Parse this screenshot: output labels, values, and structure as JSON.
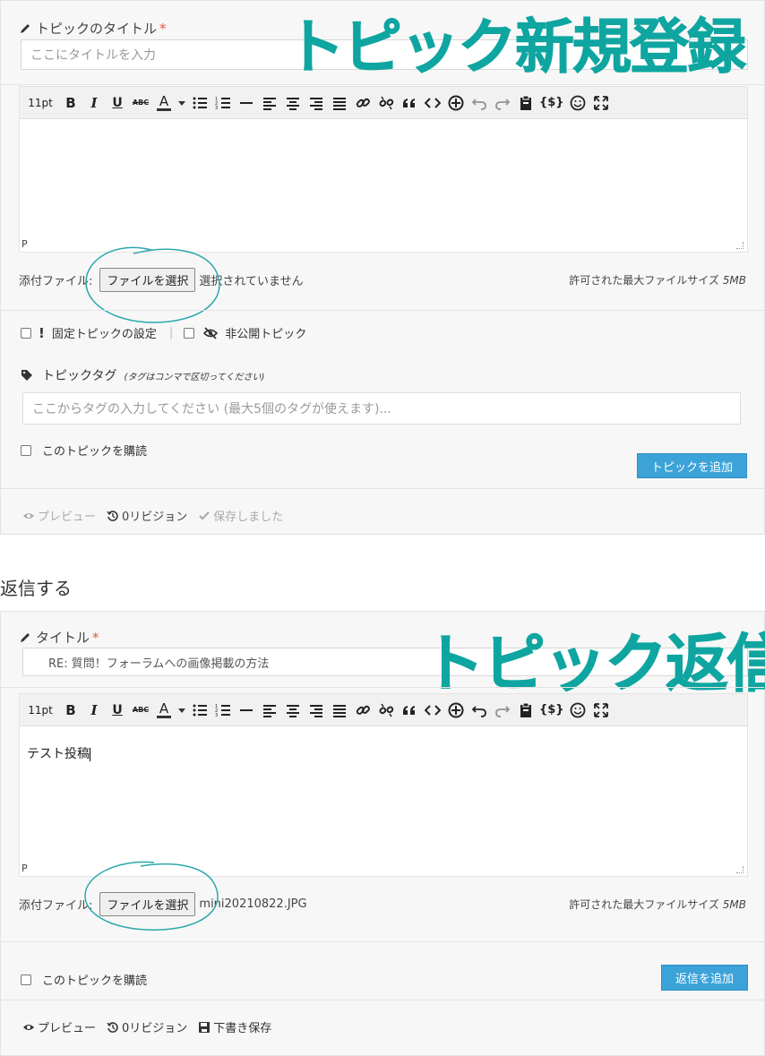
{
  "new_topic": {
    "title_label": "トピックのタイトル",
    "required_mark": "*",
    "title_placeholder": "ここにタイトルを入力",
    "stamp": "トピック新規登録",
    "editor": {
      "font_size": "11pt",
      "bold": "B",
      "italic": "I",
      "underline": "U",
      "strike": "ABC",
      "color": "A",
      "content": "",
      "status": "P"
    },
    "attach_label": "添付ファイル:",
    "file_button": "ファイルを選択",
    "file_status": "選択されていません",
    "max_size_label": "許可された最大ファイルサイズ",
    "max_size_value": "5MB",
    "sticky_label": "固定トピックの設定",
    "separator": "|",
    "private_label": "非公開トピック",
    "tags_label": "トピックタグ",
    "tags_hint": "(タグはコンマで区切ってください)",
    "tags_placeholder": "ここからタグの入力してください (最大5個のタグが使えます)...",
    "subscribe_label": "このトピックを購読",
    "submit_button": "トピックを追加",
    "footer": {
      "preview": "プレビュー",
      "revisions": "0リビジョン",
      "saved": "保存しました"
    }
  },
  "reply_heading": "返信する",
  "reply": {
    "title_label": "タイトル",
    "required_mark": "*",
    "title_value": "RE: 質問！フォーラムへの画像掲載の方法",
    "stamp": "トピック返信",
    "editor": {
      "font_size": "11pt",
      "bold": "B",
      "italic": "I",
      "underline": "U",
      "strike": "ABC",
      "color": "A",
      "content": "テスト投稿",
      "status": "P"
    },
    "attach_label": "添付ファイル:",
    "file_button": "ファイルを選択",
    "file_status": "mini20210822.JPG",
    "max_size_label": "許可された最大ファイルサイズ",
    "max_size_value": "5MB",
    "subscribe_label": "このトピックを購読",
    "submit_button": "返信を追加",
    "footer": {
      "preview": "プレビュー",
      "revisions": "0リビジョン",
      "draft": "下書き保存"
    }
  },
  "colors": {
    "accent_blue": "#3ca3d8",
    "stamp_teal": "#0fa5a0",
    "required_red": "#e2593a"
  }
}
